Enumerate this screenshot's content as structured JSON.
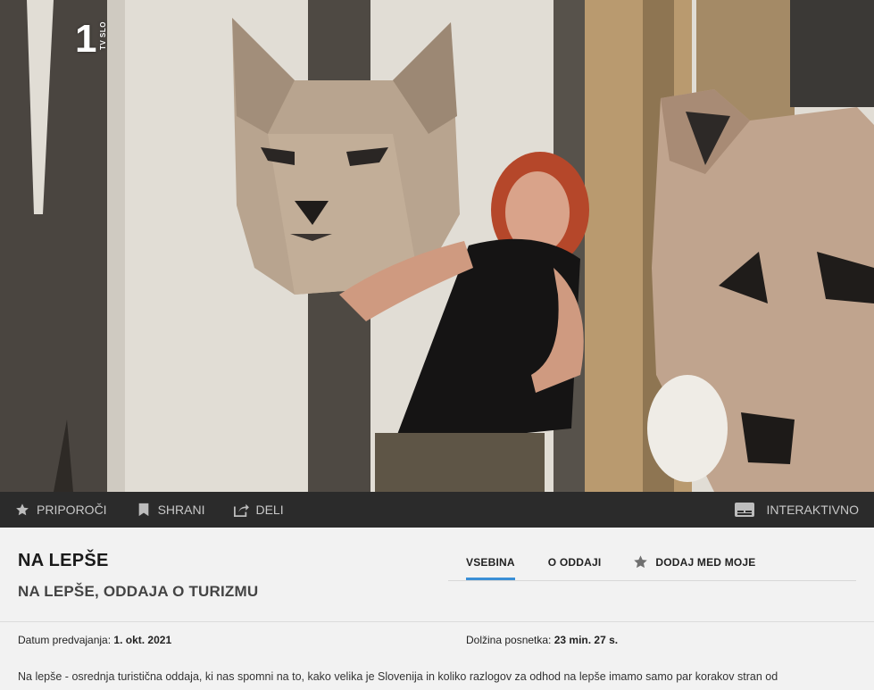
{
  "video": {
    "channel_number": "1",
    "channel_name": "TV SLO"
  },
  "action_bar": {
    "recommend_label": "PRIPOROČI",
    "save_label": "SHRANI",
    "share_label": "DELI",
    "interactive_label": "INTERAKTIVNO",
    "icons": [
      "star-icon",
      "bookmark-icon",
      "share-icon",
      "subtitles-icon"
    ]
  },
  "show": {
    "title": "NA LEPŠE",
    "subtitle": "NA LEPŠE, ODDAJA O TURIZMU"
  },
  "tabs": {
    "content_label": "VSEBINA",
    "about_label": "O ODDAJI",
    "add_label": "DODAJ MED MOJE"
  },
  "meta": {
    "air_date_label": "Datum predvajanja:",
    "air_date_value": "1. okt. 2021",
    "duration_label": "Dolžina posnetka:",
    "duration_value": "23 min. 27 s."
  },
  "description": "Na lepše - osrednja turistična oddaja, ki nas spomni na to, kako velika je Slovenija in koliko razlogov za odhod na lepše imamo samo par korakov stran od",
  "colors": {
    "action_bar_bg": "#2b2b2b",
    "active_tab_accent": "#3a8fd6",
    "page_bg": "#f2f2f2"
  }
}
